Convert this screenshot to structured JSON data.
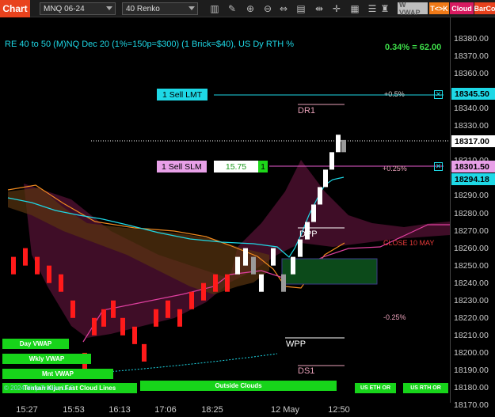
{
  "toolbar": {
    "chart_tab": "Chart",
    "instrument": "MNQ 06-24",
    "bar_type": "40 Renko",
    "buttons": [
      {
        "label": "W VWAP",
        "bg": "#bdbdbd",
        "fg": "#555"
      },
      {
        "label": "T<>K",
        "bg": "#f07a18",
        "fg": "#fff"
      },
      {
        "label": "Cloud",
        "bg": "#d81b60",
        "fg": "#fff"
      },
      {
        "label": "BarCo",
        "bg": "#e8421d",
        "fg": "#fff"
      }
    ],
    "icons": [
      "chart-type-icon",
      "drawing-tool-icon",
      "zoom-in-icon",
      "zoom-out-icon",
      "pan-icon",
      "data-box-icon",
      "bar-spacing-icon",
      "global-crosshair-icon",
      "templates-icon",
      "properties-icon",
      "strategy-icon",
      "order-panel-icon",
      "indicators-icon"
    ]
  },
  "chart": {
    "title": "RE 40 to 50 (M)NQ Dec 20 (1%=150p=$300) (1 Brick=$40), US Dy RTH %",
    "performance": "0.34% = 62.00",
    "y_ticks": [
      "18380.00",
      "18370.00",
      "18360.00",
      "18350.00",
      "18340.00",
      "18330.00",
      "18320.00",
      "18310.00",
      "18300.00",
      "18290.00",
      "18280.00",
      "18270.00",
      "18260.00",
      "18250.00",
      "18240.00",
      "18230.00",
      "18220.00",
      "18210.00",
      "18200.00",
      "18190.00",
      "18180.00",
      "18170.00"
    ],
    "x_ticks": [
      "15:27",
      "15:53",
      "16:13",
      "17:06",
      "18:25",
      "12 May",
      "12:50"
    ],
    "price_boxes": {
      "sell_lmt": "18345.50",
      "last": "18317.00",
      "sell_slm": "18301.50",
      "ema": "18294.18"
    },
    "orders": {
      "sell_lmt_label": "1 Sell LMT",
      "sell_slm_label": "1 Sell SLM",
      "sell_slm_price": "15.75",
      "sell_slm_qty": "1",
      "cancel_glyph": "✕"
    },
    "levels": {
      "plus_05": "+0.5%",
      "plus_025": "+0.25%",
      "dr1": "DR1",
      "dpp": "DPP",
      "close": "CLOSE 10 MAY",
      "minus_025": "-0.25%",
      "wpp": "WPP",
      "ds1": "DS1"
    },
    "bottom_buttons": {
      "day_vwap": "Day VWAP",
      "wkly_vwap": "Wkly VWAP",
      "mnt_vwap": "Mnt VWAP",
      "kijun": "Tenkan Kijun Fast Cloud Lines",
      "copyright": "© 2024 NinjaTrader, LLC",
      "outside_clouds": "Outside Clouds",
      "us_eth": "US ETH OR",
      "us_rth": "US RTH OR"
    }
  },
  "chart_data": {
    "type": "renko",
    "brick_size": 40,
    "y_unit": "price",
    "bricks": [
      {
        "x": 17,
        "o": 18255,
        "c": 18245,
        "dir": "down"
      },
      {
        "x": 32,
        "o": 18260,
        "c": 18250,
        "dir": "down"
      },
      {
        "x": 47,
        "o": 18255,
        "c": 18245,
        "dir": "down"
      },
      {
        "x": 62,
        "o": 18250,
        "c": 18240,
        "dir": "down"
      },
      {
        "x": 77,
        "o": 18245,
        "c": 18235,
        "dir": "down"
      },
      {
        "x": 92,
        "o": 18230,
        "c": 18220,
        "dir": "down"
      },
      {
        "x": 107,
        "o": 18200,
        "c": 18190,
        "dir": "down"
      },
      {
        "x": 119,
        "o": 18220,
        "c": 18210,
        "dir": "down"
      },
      {
        "x": 131,
        "o": 18225,
        "c": 18215,
        "dir": "down"
      },
      {
        "x": 143,
        "o": 18230,
        "c": 18220,
        "dir": "down"
      },
      {
        "x": 155,
        "o": 18220,
        "c": 18210,
        "dir": "down"
      },
      {
        "x": 170,
        "o": 18215,
        "c": 18205,
        "dir": "down"
      },
      {
        "x": 182,
        "o": 18205,
        "c": 18195,
        "dir": "down"
      },
      {
        "x": 197,
        "o": 18225,
        "c": 18215,
        "dir": "down"
      },
      {
        "x": 212,
        "o": 18230,
        "c": 18220,
        "dir": "down"
      },
      {
        "x": 227,
        "o": 18225,
        "c": 18215,
        "dir": "down"
      },
      {
        "x": 242,
        "o": 18235,
        "c": 18225,
        "dir": "down"
      },
      {
        "x": 257,
        "o": 18240,
        "c": 18230,
        "dir": "down"
      },
      {
        "x": 272,
        "o": 18245,
        "c": 18235,
        "dir": "down"
      },
      {
        "x": 287,
        "o": 18245,
        "c": 18235,
        "dir": "down"
      },
      {
        "x": 300,
        "o": 18245,
        "c": 18255,
        "dir": "up"
      },
      {
        "x": 310,
        "o": 18250,
        "c": 18260,
        "dir": "up"
      },
      {
        "x": 320,
        "o": 18245,
        "c": 18255,
        "dir": "grey"
      },
      {
        "x": 330,
        "o": 18235,
        "c": 18245,
        "dir": "up"
      },
      {
        "x": 345,
        "o": 18250,
        "c": 18260,
        "dir": "up"
      },
      {
        "x": 358,
        "o": 18235,
        "c": 18245,
        "dir": "grey"
      },
      {
        "x": 370,
        "o": 18245,
        "c": 18255,
        "dir": "up"
      },
      {
        "x": 379,
        "o": 18255,
        "c": 18265,
        "dir": "up"
      },
      {
        "x": 388,
        "o": 18265,
        "c": 18275,
        "dir": "up"
      },
      {
        "x": 396,
        "o": 18275,
        "c": 18285,
        "dir": "up"
      },
      {
        "x": 404,
        "o": 18285,
        "c": 18295,
        "dir": "up"
      },
      {
        "x": 411,
        "o": 18295,
        "c": 18305,
        "dir": "up"
      },
      {
        "x": 419,
        "o": 18305,
        "c": 18315,
        "dir": "up"
      },
      {
        "x": 427,
        "o": 18315,
        "c": 18325,
        "dir": "up"
      },
      {
        "x": 434,
        "o": 18315,
        "c": 18322,
        "dir": "grey"
      }
    ]
  }
}
